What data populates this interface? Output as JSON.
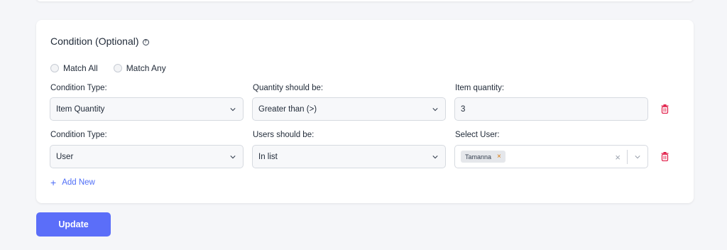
{
  "condition": {
    "title": "Condition (Optional)",
    "help_icon": "question-circle-icon",
    "match_options": [
      "Match All",
      "Match Any"
    ],
    "rows": [
      {
        "type_label": "Condition Type:",
        "type_value": "Item Quantity",
        "op_label": "Quantity should be:",
        "op_value": "Greater than (>)",
        "value_label": "Item quantity:",
        "value_value": "3"
      },
      {
        "type_label": "Condition Type:",
        "type_value": "User",
        "op_label": "Users should be:",
        "op_value": "In list",
        "value_label": "Select User:",
        "value_tag": "Tamanna",
        "tag_remove": "×",
        "clear": "×"
      }
    ],
    "add_new_label": "Add New",
    "add_plus": "+"
  },
  "update_label": "Update",
  "colors": {
    "accent": "#5b6ef9",
    "link": "#4f6ef7",
    "delete": "#e11d48"
  }
}
